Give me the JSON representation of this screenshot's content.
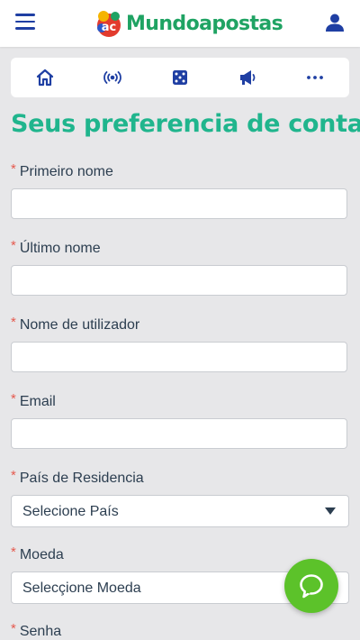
{
  "brand": {
    "name": "Mundoapostas",
    "colors": {
      "primary": "#1f3fa3",
      "accent": "#20b58d",
      "logo_text": "#1fa363",
      "required": "#e55a4f",
      "chat": "#5cc22a"
    }
  },
  "header": {
    "menu_icon": "hamburger-menu-icon",
    "account_icon": "user-account-icon"
  },
  "nav": {
    "items": [
      {
        "icon": "home-icon"
      },
      {
        "icon": "live-broadcast-icon"
      },
      {
        "icon": "dice-icon"
      },
      {
        "icon": "megaphone-icon"
      },
      {
        "icon": "more-dots-icon"
      }
    ]
  },
  "page": {
    "title": "Seus preferencia de conta"
  },
  "form": {
    "required_marker": "*",
    "first_name_label": "Primeiro nome",
    "first_name_value": "",
    "last_name_label": "Último nome",
    "last_name_value": "",
    "username_label": "Nome de utilizador",
    "username_value": "",
    "email_label": "Email",
    "email_value": "",
    "country_label": "País de Residencia",
    "country_selected": "Selecione País",
    "currency_label": "Moeda",
    "currency_selected": "Selecçione Moeda",
    "password_label": "Senha"
  },
  "chat": {
    "icon": "chat-bubble-icon"
  }
}
